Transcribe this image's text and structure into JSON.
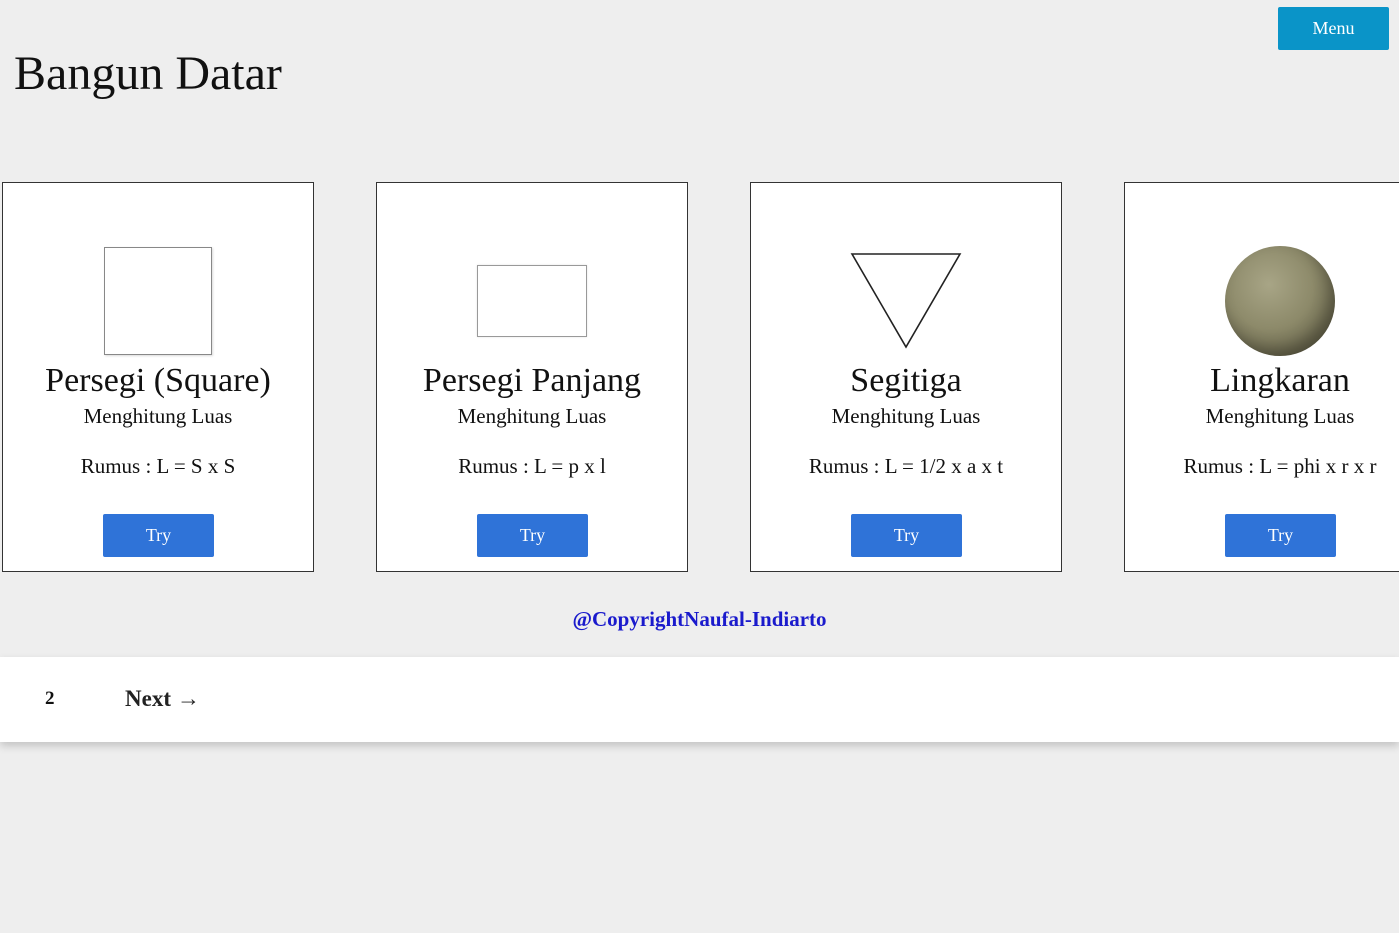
{
  "header": {
    "title": "Bangun Datar",
    "menu_label": "Menu"
  },
  "cards": [
    {
      "icon": "square-shape",
      "title": "Persegi (Square)",
      "subtitle": "Menghitung Luas",
      "formula": "Rumus : L = S x S",
      "button_label": "Try"
    },
    {
      "icon": "rectangle-shape",
      "title": "Persegi Panjang",
      "subtitle": "Menghitung Luas",
      "formula": "Rumus : L = p x l",
      "button_label": "Try"
    },
    {
      "icon": "triangle-shape",
      "title": "Segitiga",
      "subtitle": "Menghitung Luas",
      "formula": "Rumus : L = 1/2 x a x t",
      "button_label": "Try"
    },
    {
      "icon": "circle-ball-image",
      "title": "Lingkaran",
      "subtitle": "Menghitung Luas",
      "formula": "Rumus : L = phi x r x r",
      "button_label": "Try"
    }
  ],
  "footer": {
    "copyright": "@CopyrightNaufal-Indiarto"
  },
  "pagination": {
    "page_number": "2",
    "next_label": "Next",
    "next_arrow": "→"
  },
  "colors": {
    "background": "#eeeeee",
    "menu_button": "#0a94c8",
    "try_button": "#2f73d8",
    "copyright_text": "#1a1acc"
  }
}
